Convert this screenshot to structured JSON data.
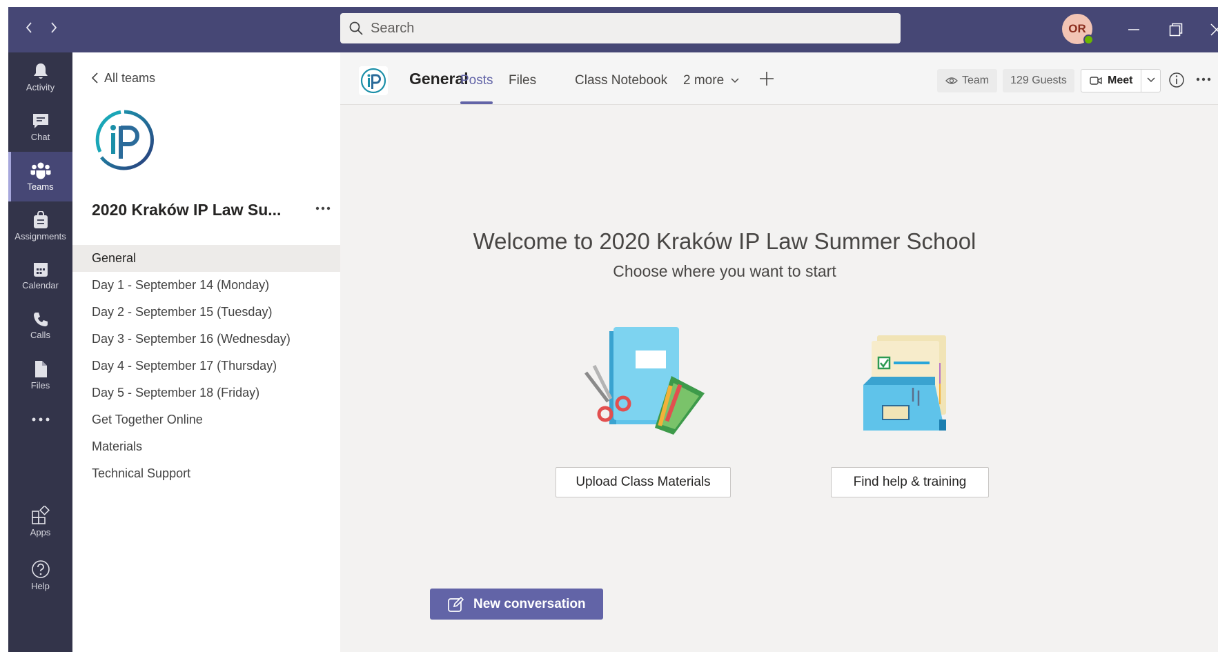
{
  "app": {
    "accent": "#6264a7",
    "titlebar_color": "#464775",
    "rail_color": "#33344a"
  },
  "titlebar": {
    "back_icon": "chevron-left-icon",
    "forward_icon": "chevron-right-icon",
    "search_placeholder": "Search",
    "avatar_initials": "OR",
    "presence": "available"
  },
  "rail": {
    "items": [
      {
        "label": "Activity",
        "icon": "bell-icon"
      },
      {
        "label": "Chat",
        "icon": "chat-icon"
      },
      {
        "label": "Teams",
        "icon": "teams-icon",
        "active": true
      },
      {
        "label": "Assignments",
        "icon": "assignments-icon"
      },
      {
        "label": "Calendar",
        "icon": "calendar-icon"
      },
      {
        "label": "Calls",
        "icon": "phone-icon"
      },
      {
        "label": "Files",
        "icon": "file-icon"
      }
    ],
    "more_icon": "ellipsis-icon",
    "bottom": [
      {
        "label": "Apps",
        "icon": "apps-icon"
      },
      {
        "label": "Help",
        "icon": "help-icon"
      }
    ]
  },
  "panel": {
    "all_teams": "All teams",
    "team_name": "2020 Kraków IP Law Su...",
    "team_logo_text": "iP",
    "channels": [
      "General",
      "Day 1 - September 14 (Monday)",
      "Day 2 - September 15 (Tuesday)",
      "Day 3 - September 16 (Wednesday)",
      "Day 4 - September 17 (Thursday)",
      "Day 5 - September 18 (Friday)",
      "Get Together Online",
      "Materials",
      "Technical Support"
    ],
    "selected_channel": "General"
  },
  "header": {
    "channel_title": "General",
    "tabs": [
      "Posts",
      "Files",
      "Class Notebook",
      "2 more"
    ],
    "active_tab": "Posts",
    "team_label": "Team",
    "guests_label": "129 Guests",
    "meet_label": "Meet"
  },
  "main": {
    "welcome_title": "Welcome to 2020 Kraków IP Law Summer School",
    "welcome_subtitle": "Choose where you want to start",
    "upload_button": "Upload Class Materials",
    "help_button": "Find help & training",
    "new_conversation": "New conversation"
  }
}
